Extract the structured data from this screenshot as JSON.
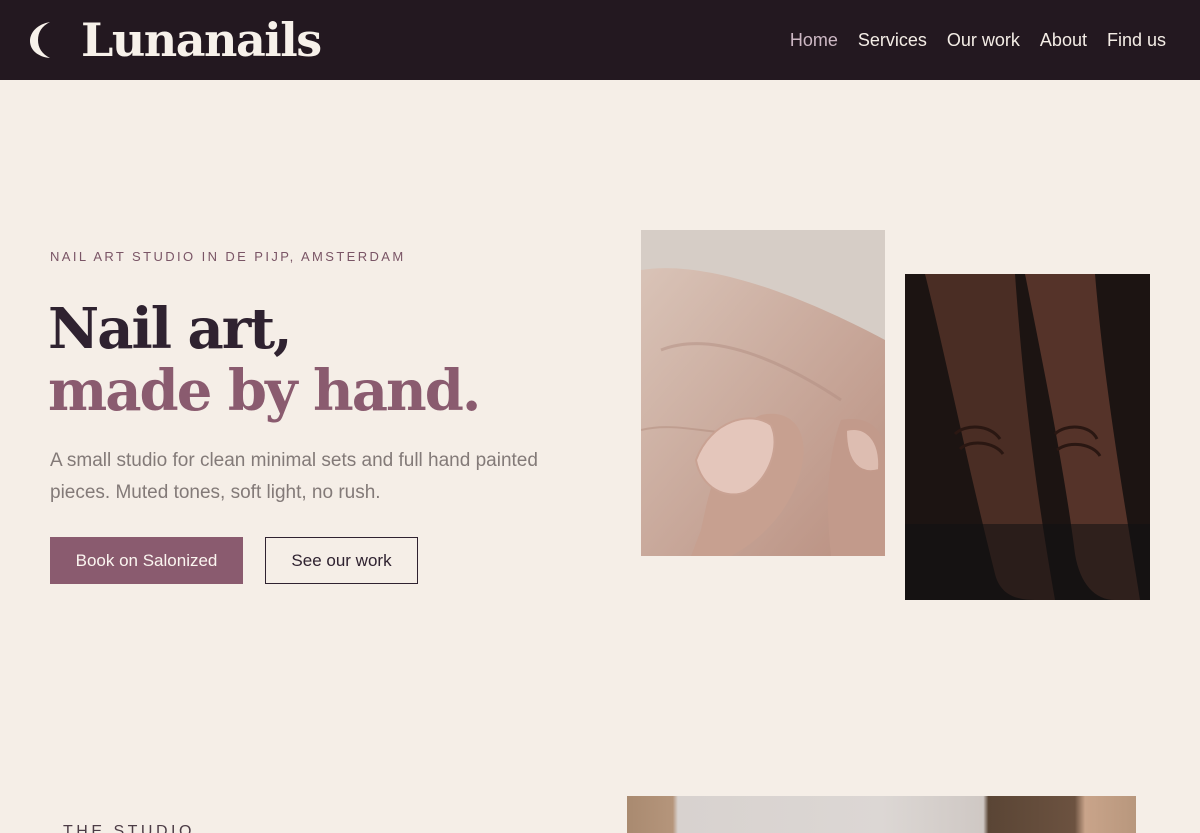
{
  "header": {
    "brand": "Lunanails",
    "nav": [
      {
        "label": "Home",
        "active": true
      },
      {
        "label": "Services",
        "active": false
      },
      {
        "label": "Our work",
        "active": false
      },
      {
        "label": "About",
        "active": false
      },
      {
        "label": "Find us",
        "active": false
      }
    ]
  },
  "hero": {
    "eyebrow": "NAIL ART STUDIO IN DE PIJP, AMSTERDAM",
    "headline_line1": "Nail art,",
    "headline_line2": "made by hand.",
    "lede": "A small studio for clean minimal sets and full hand painted pieces. Muted tones, soft light, no rush.",
    "primary_cta": "Book on Salonized",
    "secondary_cta": "See our work",
    "photos": [
      {
        "icon": "manicured-hand-photo"
      },
      {
        "icon": "dark-skin-hand-photo"
      }
    ]
  },
  "studio": {
    "eyebrow": "THE STUDIO"
  },
  "colors": {
    "header_bg": "#231820",
    "page_bg": "#f5eee7",
    "accent_plum": "#8a5b6f",
    "text_dark": "#2f2230",
    "text_muted": "#837a78",
    "nav_active": "#cdb8c4"
  }
}
